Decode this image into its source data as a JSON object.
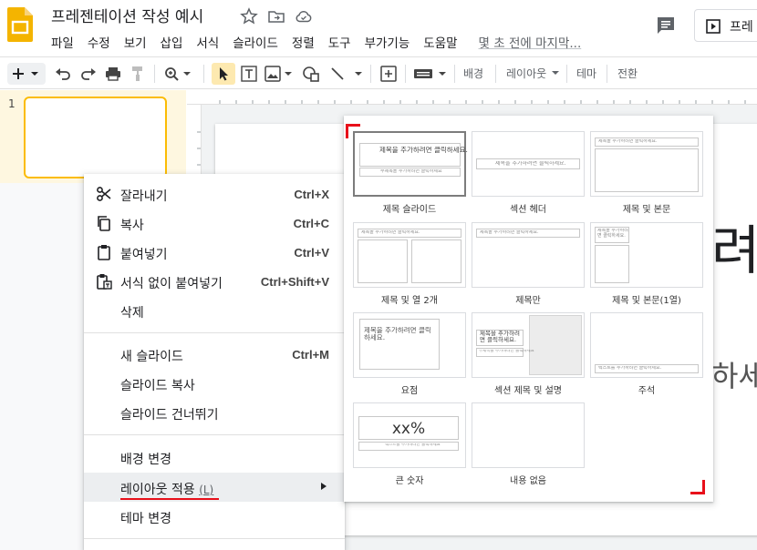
{
  "header": {
    "title": "프레젠테이션 작성 예시",
    "menu": [
      "파일",
      "수정",
      "보기",
      "삽입",
      "서식",
      "슬라이드",
      "정렬",
      "도구",
      "부가기능",
      "도움말"
    ],
    "last_edit": "몇 초 전에 마지막...",
    "present_label": "프레",
    "icons": [
      "star-icon",
      "move-to-folder-icon",
      "cloud-saved-icon",
      "comment-icon",
      "present-icon"
    ]
  },
  "toolbar": {
    "background_label": "배경",
    "layout_label": "레이아웃",
    "theme_label": "테마",
    "transition_label": "전환"
  },
  "filmstrip": {
    "slide_number": "1"
  },
  "slide": {
    "title_fragment": "려|",
    "subtitle_fragment": "하세"
  },
  "context_menu": {
    "items": [
      {
        "label": "잘라내기",
        "shortcut": "Ctrl+X",
        "icon": "scissors-icon"
      },
      {
        "label": "복사",
        "shortcut": "Ctrl+C",
        "icon": "copy-icon"
      },
      {
        "label": "붙여넣기",
        "shortcut": "Ctrl+V",
        "icon": "clipboard-icon"
      },
      {
        "label": "서식 없이 붙여넣기",
        "shortcut": "Ctrl+Shift+V",
        "icon": "paste-plain-icon"
      },
      {
        "label": "삭제",
        "shortcut": ""
      },
      {
        "label": "새 슬라이드",
        "shortcut": "Ctrl+M"
      },
      {
        "label": "슬라이드 복사",
        "shortcut": ""
      },
      {
        "label": "슬라이드 건너뛰기",
        "shortcut": ""
      },
      {
        "label": "배경 변경",
        "shortcut": ""
      },
      {
        "label": "레이아웃 적용",
        "accelerator": "(L)",
        "shortcut": ""
      },
      {
        "label": "테마 변경",
        "shortcut": ""
      }
    ]
  },
  "layout_submenu": {
    "tiles": [
      {
        "label": "제목 슬라이드",
        "title": "제목을 추가하려면 클릭하세요.",
        "sub": "부제목을 추가하려면 클릭하세요"
      },
      {
        "label": "섹션 헤더",
        "title": "제목을 추가하려면 클릭하세요."
      },
      {
        "label": "제목 및 본문",
        "title": "제목을 추가하려면 클릭하세요."
      },
      {
        "label": "제목 및 열 2개",
        "title": "제목을 추가하려면 클릭하세요."
      },
      {
        "label": "제목만",
        "title": "제목을 추가하려면 클릭하세요."
      },
      {
        "label": "제목 및 본문(1열)",
        "title": "제목을 추가하려면 클릭하세요."
      },
      {
        "label": "요점",
        "title": "제목을 추가하려면 클릭하세요."
      },
      {
        "label": "섹션 제목 및 설명",
        "title": "제목을 추가하려면 클릭하세요.",
        "sub": "부제목을 추가하려면 클릭하세요"
      },
      {
        "label": "주석",
        "title": "텍스트를 추가하려면 클릭하세요."
      },
      {
        "label": "큰 숫자",
        "title": "xx%",
        "sub": "텍스트를 추가하려면 클릭하세요"
      },
      {
        "label": "내용 없음"
      }
    ]
  },
  "colors": {
    "accent_yellow": "#fbbc04",
    "selection_bg": "#fef7e0",
    "annotation_red": "#e8101a"
  }
}
